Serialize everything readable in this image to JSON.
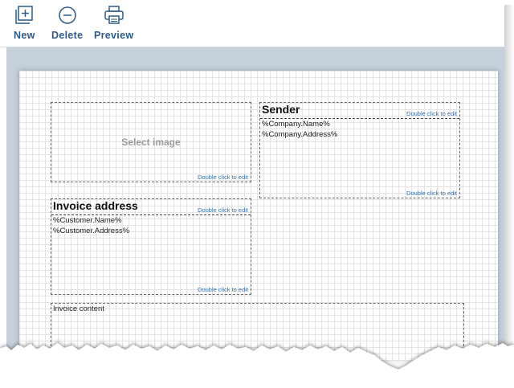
{
  "toolbar": {
    "buttons": [
      {
        "label": "New",
        "icon": "new-document-icon"
      },
      {
        "label": "Delete",
        "icon": "remove-circle-icon"
      },
      {
        "label": "Preview",
        "icon": "printer-icon"
      }
    ]
  },
  "template": {
    "logo": {
      "placeholder": "Select image",
      "hint": "Double click to edit"
    },
    "sender": {
      "title": "Sender",
      "hint_title": "Double click to edit",
      "lines": [
        "%Company.Name%",
        "%Company.Address%"
      ],
      "hint_body": "Double click to edit"
    },
    "invoice_address": {
      "title": "Invoice address",
      "hint_title": "Double click to edit",
      "lines": [
        "%Customer.Name%",
        "%Customer.Address%"
      ],
      "hint_body": "Double click to edit"
    },
    "invoice_content": {
      "label": "Invoice content"
    }
  },
  "colors": {
    "accent": "#2d5a86",
    "hint": "#3a6fa6",
    "canvas_bg": "#c6d0db"
  }
}
